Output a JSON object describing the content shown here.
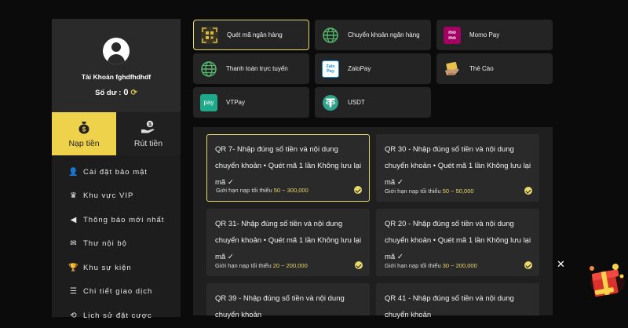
{
  "sidebar": {
    "account": "Tài Khoản fghdfhdhdf",
    "balance_label": "Số dư :",
    "balance_value": "0",
    "tabs": [
      {
        "label": "Nạp tiền",
        "icon": "deposit-bag-icon",
        "active": true
      },
      {
        "label": "Rút tiền",
        "icon": "withdraw-hand-icon",
        "active": false
      }
    ],
    "menu": [
      {
        "label": "Cài đặt bảo mật",
        "icon": "user-lock-icon"
      },
      {
        "label": "Khu vực VIP",
        "icon": "crown-icon"
      },
      {
        "label": "Thông báo mới nhất",
        "icon": "megaphone-icon"
      },
      {
        "label": "Thư nội bộ",
        "icon": "envelope-icon"
      },
      {
        "label": "Khu sự kiện",
        "icon": "trophy-icon"
      },
      {
        "label": "Chi tiết giao dịch",
        "icon": "list-icon"
      },
      {
        "label": "Lịch sử đặt cược",
        "icon": "history-icon"
      }
    ]
  },
  "methods": [
    {
      "label": "Quét mã ngân hàng",
      "icon": "qr-scan-icon",
      "active": true
    },
    {
      "label": "Chuyển khoản ngân hàng",
      "icon": "globe-icon"
    },
    {
      "label": "Momo Pay",
      "icon": "momo-icon",
      "icon_text": "mo mo"
    },
    {
      "label": "Thanh toán trực tuyến",
      "icon": "globe-icon"
    },
    {
      "label": "ZaloPay",
      "icon": "zalopay-icon",
      "icon_text": "Zalo Pay"
    },
    {
      "label": "Thẻ Cào",
      "icon": "scratch-card-icon"
    },
    {
      "label": "VTPay",
      "icon": "vtpay-icon",
      "icon_text": "pay"
    },
    {
      "label": "USDT",
      "icon": "tether-icon"
    }
  ],
  "qr_cards": [
    {
      "title": "QR 7- Nhập đúng số tiền và nội dung chuyển khoản • Quét mã 1 lần Không lưu lại mã ✓",
      "limit_label": "Giới hạn nạp tối thiểu",
      "range": "50 ~ 300,000",
      "active": true
    },
    {
      "title": "QR 30 - Nhập đúng số tiền và nội dung chuyển khoản • Quét mã 1 lần Không lưu lại mã ✓",
      "limit_label": "Giới hạn nạp tối thiểu",
      "range": "50 ~ 50,000"
    },
    {
      "title": "QR 31- Nhập đúng số tiền và nội dung chuyển khoản • Quét mã 1 lần Không lưu lại mã ✓",
      "limit_label": "Giới hạn nạp tối thiểu",
      "range": "20 ~ 200,000"
    },
    {
      "title": "QR 20 - Nhập đúng số tiền và nội dung chuyển khoản • Quét mã 1 lần Không lưu lại mã ✓",
      "limit_label": "Giới hạn nạp tối thiểu",
      "range": "30 ~ 200,000"
    },
    {
      "title": "QR 39 - Nhập đúng số tiền và nội dung chuyển khoản",
      "limit_label": "",
      "range": ""
    },
    {
      "title": "QR 41 - Nhập đúng số tiền và nội dung chuyển khoản",
      "limit_label": "",
      "range": ""
    }
  ],
  "close_symbol": "✕",
  "colors": {
    "accent": "#efd24b",
    "card": "#2a2a2a",
    "panel": "#1f1f1f",
    "background": "#0b0b0b"
  }
}
